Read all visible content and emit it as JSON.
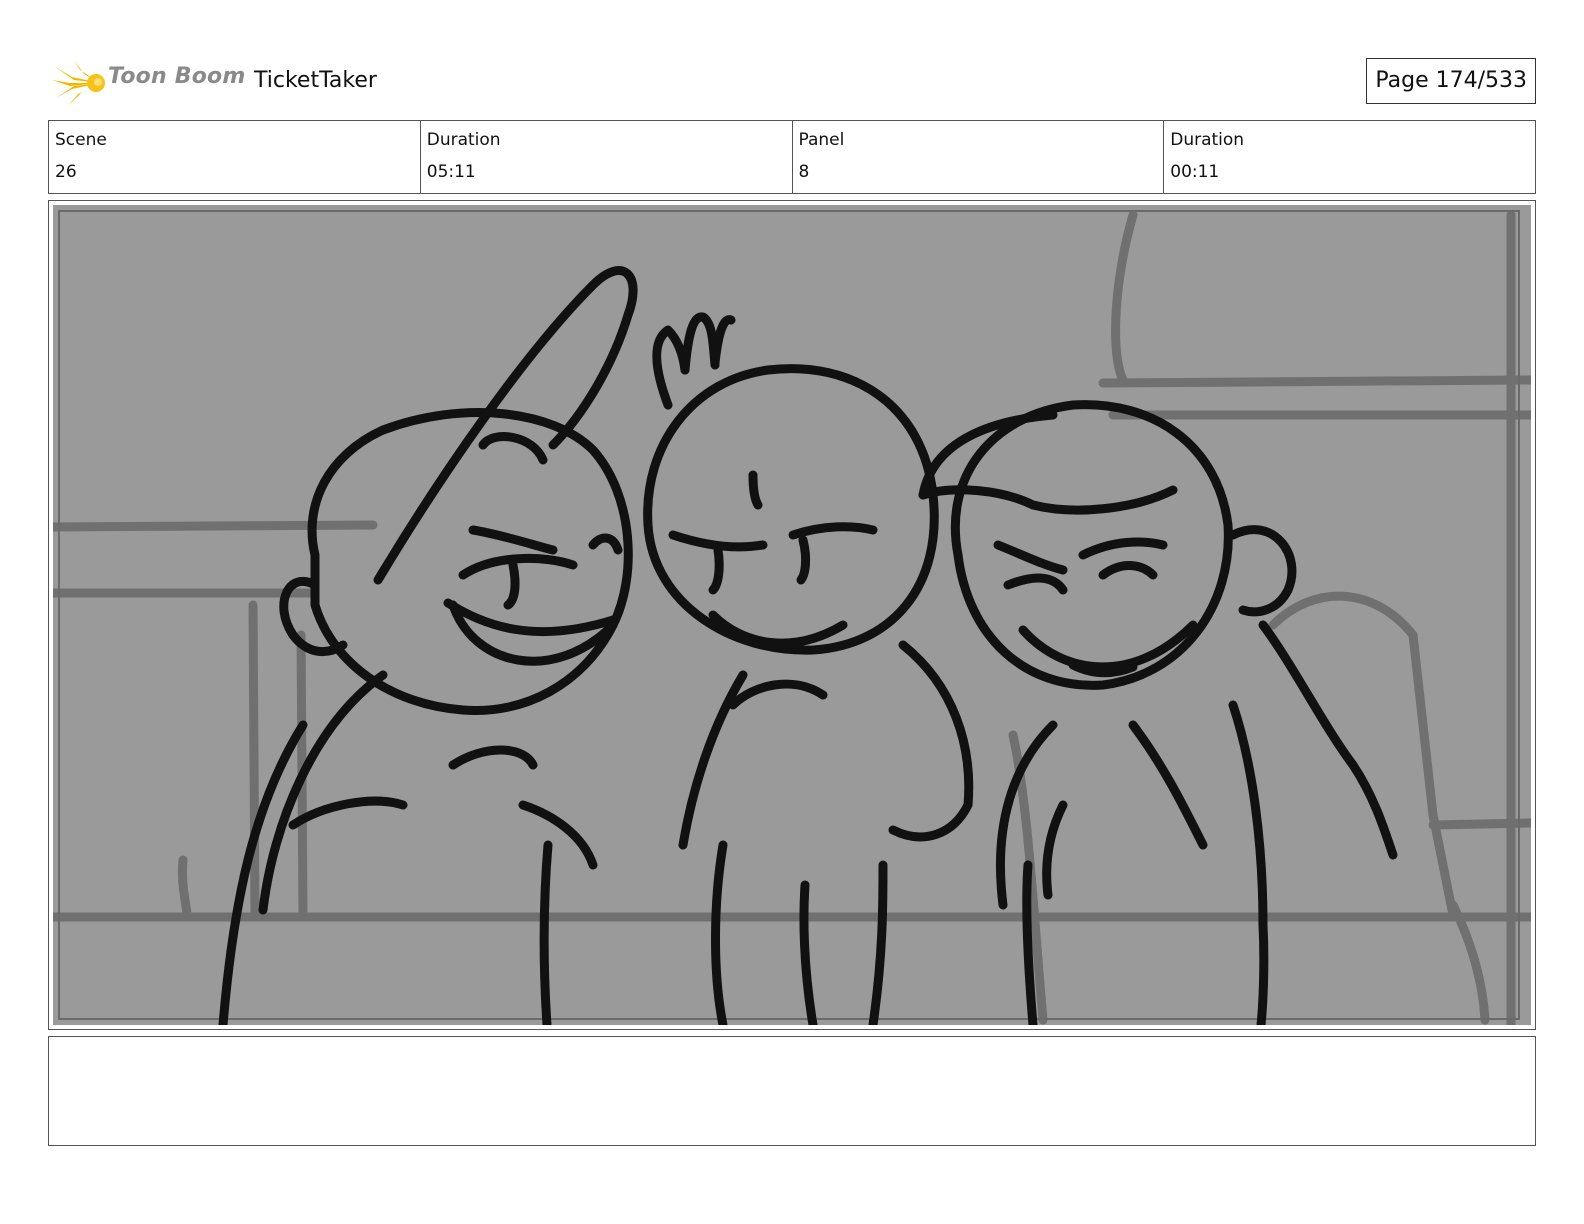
{
  "header": {
    "brand": "Toon Boom",
    "project_title": "TicketTaker",
    "page_label": "Page 174/533"
  },
  "info": {
    "scene_label": "Scene",
    "scene_value": "26",
    "scene_duration_label": "Duration",
    "scene_duration_value": "05:11",
    "panel_label": "Panel",
    "panel_value": "8",
    "panel_duration_label": "Duration",
    "panel_duration_value": "00:11"
  },
  "colors": {
    "panel_background": "#9a9a9a",
    "line_art": "#111111",
    "background_lines": "#707070",
    "logo_accent": "#f5b800",
    "logo_text": "#8a8a8a"
  },
  "panel_image": {
    "icon": "storyboard-sketch"
  },
  "notes": {
    "text": ""
  }
}
